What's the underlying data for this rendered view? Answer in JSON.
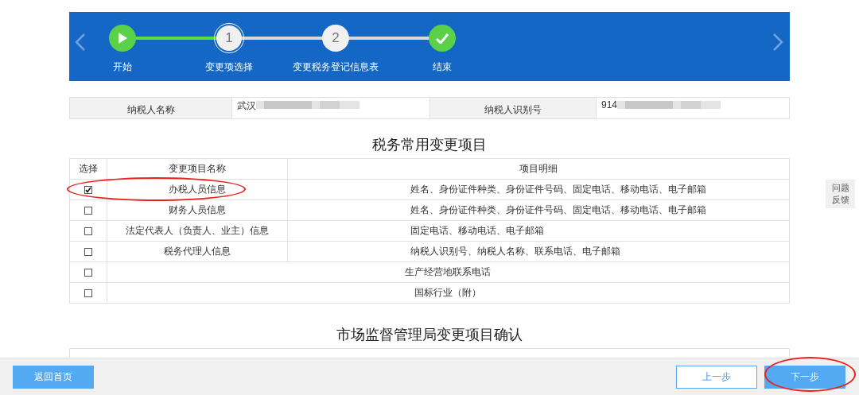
{
  "stepper": {
    "steps": [
      {
        "label": "开始",
        "kind": "start",
        "completed": true,
        "current": false
      },
      {
        "label": "变更项选择",
        "kind": "number",
        "number": "1",
        "completed": false,
        "current": true
      },
      {
        "label": "变更税务登记信息表",
        "kind": "number",
        "number": "2",
        "completed": false,
        "current": false
      },
      {
        "label": "结束",
        "kind": "end",
        "completed": true,
        "current": false
      }
    ]
  },
  "taxpayer": {
    "name_label": "纳税人名称",
    "name_value": "武汉",
    "id_label": "纳税人识别号",
    "id_value": "914"
  },
  "common_changes": {
    "title": "税务常用变更项目",
    "columns": [
      "选择",
      "变更项目名称",
      "项目明细"
    ],
    "rows": [
      {
        "checked": true,
        "name": "办税人员信息",
        "detail": "姓名、身份证件种类、身份证件号码、固定电话、移动电话、电子邮箱"
      },
      {
        "checked": false,
        "name": "财务人员信息",
        "detail": "姓名、身份证件种类、身份证件号码、固定电话、移动电话、电子邮箱"
      },
      {
        "checked": false,
        "name": "法定代表人（负责人、业主）信息",
        "detail": "固定电话、移动电话、电子邮箱"
      },
      {
        "checked": false,
        "name": "税务代理人信息",
        "detail": "纳税人识别号、纳税人名称、联系电话、电子邮箱"
      },
      {
        "checked": false,
        "name": "生产经营地联系电话"
      },
      {
        "checked": false,
        "name": "国标行业（附）"
      }
    ]
  },
  "market_changes": {
    "title": "市场监督管理局变更项目确认"
  },
  "feedback": {
    "label": "问题反馈"
  },
  "footer": {
    "home": "返回首页",
    "prev": "上一步",
    "next": "下一步"
  }
}
